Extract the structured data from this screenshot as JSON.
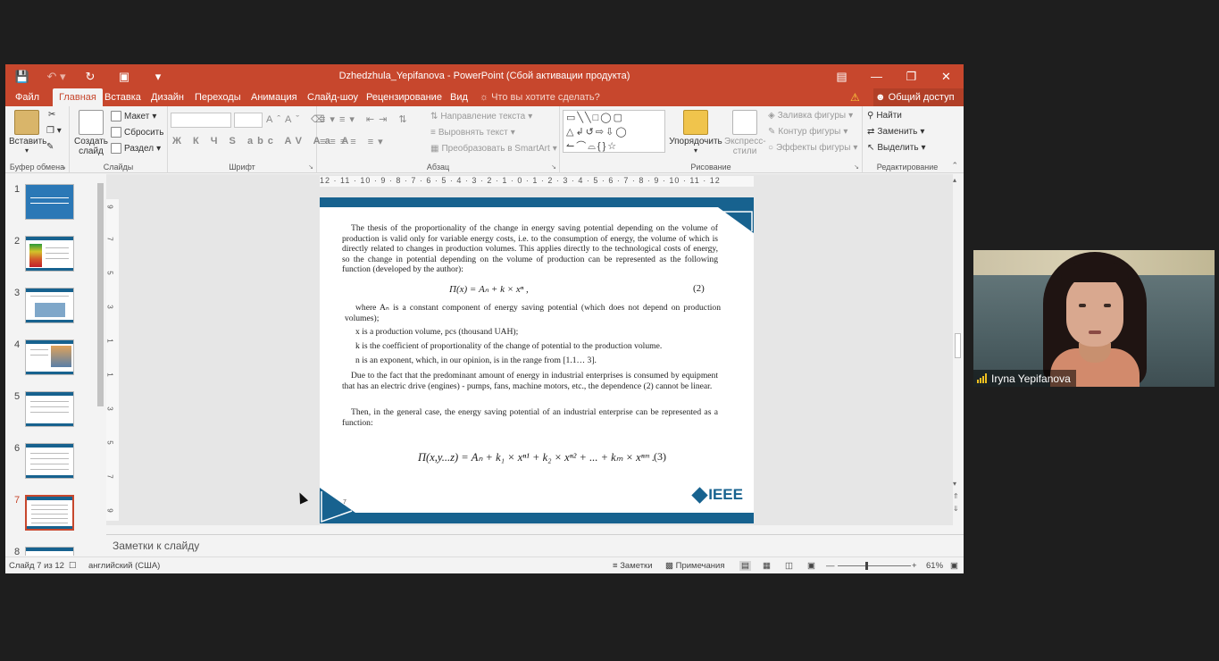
{
  "window": {
    "title": "Dzhedzhula_Yepifanova - PowerPoint (Сбой активации продукта)",
    "qat_icons": [
      "save-icon",
      "undo-icon",
      "redo-icon",
      "present-icon",
      "customize-icon"
    ]
  },
  "tabs": [
    "Файл",
    "Главная",
    "Вставка",
    "Дизайн",
    "Переходы",
    "Анимация",
    "Слайд-шоу",
    "Рецензирование",
    "Вид"
  ],
  "active_tab": "Главная",
  "tell_me": "Что вы хотите сделать?",
  "share": "Общий доступ",
  "ribbon": {
    "clipboard": {
      "paste": "Вставить",
      "label": "Буфер обмена"
    },
    "slides": {
      "new_slide_1": "Создать",
      "new_slide_2": "слайд",
      "layout": "Макет",
      "reset": "Сбросить",
      "section": "Раздел",
      "label": "Слайды"
    },
    "font": {
      "label": "Шрифт",
      "row2": "Ж К Ч S abc AV Aa A"
    },
    "paragraph": {
      "text_direction": "Направление текста",
      "align_text": "Выровнять текст",
      "smartart": "Преобразовать в SmartArt",
      "label": "Абзац"
    },
    "drawing": {
      "arrange": "Упорядочить",
      "quick_styles_1": "Экспресс-",
      "quick_styles_2": "стили",
      "fill": "Заливка фигуры",
      "outline": "Контур фигуры",
      "effects": "Эффекты фигуры",
      "label": "Рисование"
    },
    "editing": {
      "find": "Найти",
      "replace": "Заменить",
      "select": "Выделить",
      "label": "Редактирование"
    }
  },
  "thumbnails": [
    "1",
    "2",
    "3",
    "4",
    "5",
    "6",
    "7",
    "8"
  ],
  "active_slide": "7",
  "ruler_h": "12 · 11 · 10 · 9 · 8 · 7 · 6 · 5 · 4 · 3 · 2 · 1 · 0 · 1 · 2 · 3 · 4 · 5 · 6 · 7 · 8 · 9 · 10 · 11 · 12",
  "slide": {
    "para1": "The thesis of the proportionality of the change in energy saving potential depending on the volume of production is valid only for variable energy costs, i.e. to the consumption of energy, the volume of which is directly related to changes in production volumes. This applies directly to the technological costs of energy, so the change in potential depending on the volume of production can be represented as the following function (developed by the author):",
    "eq2": "П(x) = Aₙ + k × xⁿ ,",
    "eq2_num": "(2)",
    "where": "where Aₙ is a constant component of energy saving potential (which does not depend on production volumes);",
    "x_def": "x is a production volume, pcs (thousand UAH);",
    "k_def": "k is the coefficient of proportionality of the change of potential to the production volume.",
    "n_def": "n is an exponent, which, in our opinion, is in the range from [1.1… 3].",
    "para2": "Due to the fact that the predominant amount of energy in industrial enterprises is consumed by equipment that has an electric drive (engines) - pumps, fans, machine motors, etc., the dependence (2) cannot be linear.",
    "para3": "Then, in the general case, the energy saving potential of an industrial enterprise can be represented as a function:",
    "eq3": "П(x,y...z) = Aₙ + k₁ × xⁿ¹ + k₂ × xⁿ² + ... + kₘ × xⁿᵐ .",
    "eq3_num": "(3)",
    "page": "7",
    "logo": "IEEE"
  },
  "notes_placeholder": "Заметки к слайду",
  "status": {
    "slide_of": "Слайд 7 из 12",
    "language": "английский (США)",
    "notes": "Заметки",
    "comments": "Примечания",
    "zoom": "61%"
  },
  "video": {
    "name": "Iryna Yepifanova"
  },
  "colors": {
    "accent": "#c7472d",
    "slide_blue": "#17628f"
  }
}
